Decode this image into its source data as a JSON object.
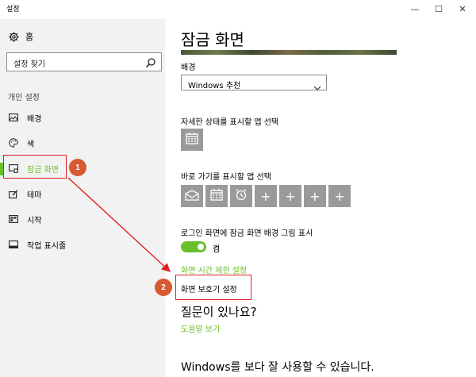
{
  "window": {
    "title": "설정",
    "minimize": "—",
    "maximize": "☐",
    "close": "✕"
  },
  "sidebar": {
    "home_label": "홈",
    "search_placeholder": "설정 찾기",
    "section_label": "개인 설정",
    "items": [
      {
        "label": "배경",
        "icon": "picture-icon"
      },
      {
        "label": "색",
        "icon": "palette-icon"
      },
      {
        "label": "잠금 화면",
        "icon": "lock-screen-icon",
        "selected": true
      },
      {
        "label": "테마",
        "icon": "theme-icon"
      },
      {
        "label": "시작",
        "icon": "start-icon"
      },
      {
        "label": "작업 표시줄",
        "icon": "taskbar-icon"
      }
    ]
  },
  "main": {
    "title": "잠금 화면",
    "background_label": "배경",
    "background_value": "Windows 추천",
    "detail_label": "자세한 상태를 표시할 앱 선택",
    "quick_label": "바로 가기를 표시할 앱 선택",
    "quick_tiles": [
      "mail-icon",
      "calendar-icon",
      "alarm-icon",
      "+",
      "+",
      "+",
      "+"
    ],
    "signin_label": "로그인 화면에 잠금 화면 배경 그림 표시",
    "toggle_state": "켬",
    "screen_timeout_link": "화면 시간 제한 설정",
    "screensaver_link": "화면 보호기 설정",
    "question_heading": "질문이 있나요?",
    "help_link": "도움말 보기",
    "better_heading": "Windows를 보다 잘 사용할 수 있습니다."
  },
  "annotations": {
    "badge1": "1",
    "badge2": "2",
    "highlight_color": "#e02020",
    "badge_color": "#d65a31"
  },
  "colors": {
    "accent": "#6bbf2a",
    "sidebar_bg": "#f2f2f2",
    "tile_bg": "#9a9a9a"
  }
}
